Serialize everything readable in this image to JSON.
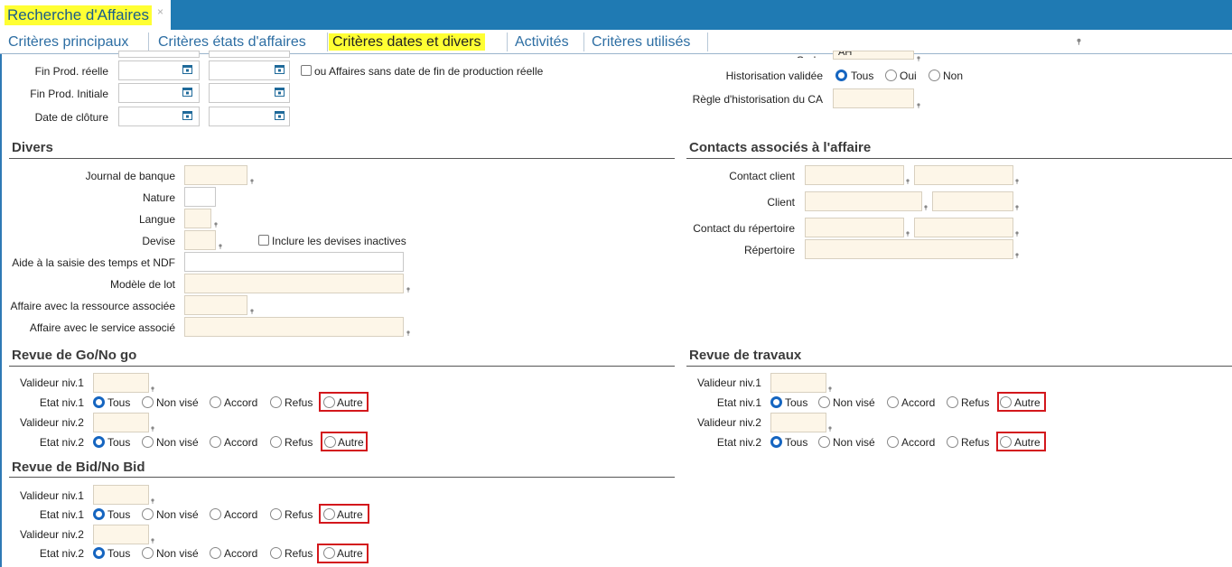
{
  "window": {
    "doc_tab_title": "Recherche d'Affaires",
    "close_glyph": "×"
  },
  "tabs": [
    {
      "label": "Critères principaux"
    },
    {
      "label": "Critères états d'affaires"
    },
    {
      "label": "Critères dates et divers"
    },
    {
      "label": "Activités"
    },
    {
      "label": "Critères utilisés"
    }
  ],
  "dates": {
    "fin_prod_reelle": "Fin Prod. réelle",
    "fin_prod_initiale": "Fin Prod. Initiale",
    "date_cloture": "Date de clôture",
    "sans_date_fin": "ou Affaires sans date de fin de production réelle"
  },
  "right_top": {
    "code": "Code",
    "code_value": "AH",
    "historisation_validee": "Historisation validée",
    "hist_options": [
      "Tous",
      "Oui",
      "Non"
    ],
    "regle_historisation": "Règle d'historisation du CA"
  },
  "divers": {
    "title": "Divers",
    "journal_banque": "Journal de banque",
    "nature": "Nature",
    "langue": "Langue",
    "devise": "Devise",
    "inclure_devises": "Inclure les devises inactives",
    "aide_saisie": "Aide à la saisie des temps et NDF",
    "modele_lot": "Modèle de lot",
    "affaire_ressource": "Affaire avec la ressource associée",
    "affaire_service": "Affaire avec le service associé"
  },
  "contacts": {
    "title": "Contacts associés à l'affaire",
    "contact_client": "Contact client",
    "client": "Client",
    "contact_repertoire": "Contact du répertoire",
    "repertoire": "Répertoire"
  },
  "revue_go": {
    "title": "Revue de Go/No go",
    "valideur1": "Valideur niv.1",
    "etat1": "Etat niv.1",
    "valideur2": "Valideur niv.2",
    "etat2": "Etat niv.2"
  },
  "revue_bid": {
    "title": "Revue de Bid/No Bid",
    "valideur1": "Valideur niv.1",
    "etat1": "Etat niv.1",
    "valideur2": "Valideur niv.2",
    "etat2": "Etat niv.2"
  },
  "revue_travaux": {
    "title": "Revue de travaux",
    "valideur1": "Valideur niv.1",
    "etat1": "Etat niv.1",
    "valideur2": "Valideur niv.2",
    "etat2": "Etat niv.2"
  },
  "etat_options": [
    "Tous",
    "Non visé",
    "Accord",
    "Refus",
    "Autre"
  ],
  "colors": {
    "accent": "#1f7ab3",
    "highlight": "#ffff33",
    "radio_on": "#1565c0",
    "annotation": "#d3171c",
    "filled_input": "#fdf6e8"
  }
}
